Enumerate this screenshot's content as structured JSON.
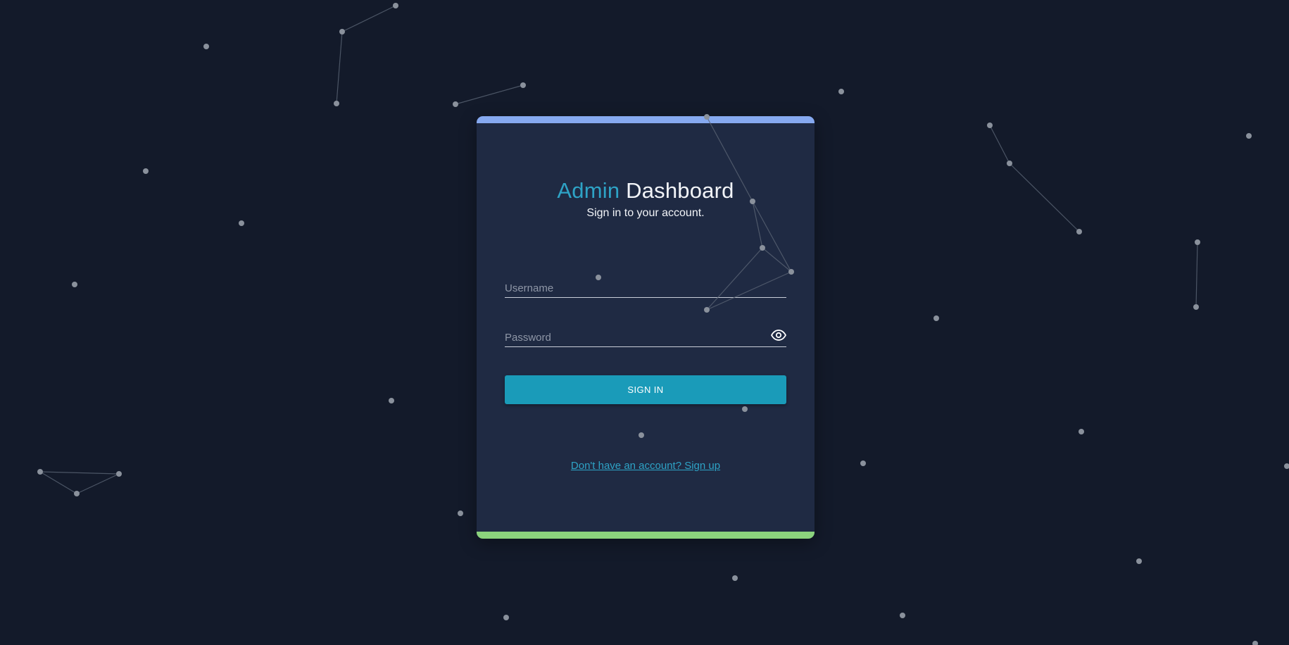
{
  "header": {
    "title_accent": "Admin",
    "title_main": "Dashboard",
    "subtitle": "Sign in to your account."
  },
  "form": {
    "username_placeholder": "Username",
    "password_placeholder": "Password",
    "password_toggle_icon": "eye-icon",
    "submit_label": "SIGN IN"
  },
  "signup_link": "Don't have an account? Sign up",
  "colors": {
    "page_background": "#131a2a",
    "card_background": "#1f2a43",
    "top_stripe": "#86a9f0",
    "bottom_stripe": "#8bd37d",
    "accent": "#2ea3c6",
    "button": "#1a9bb9"
  }
}
